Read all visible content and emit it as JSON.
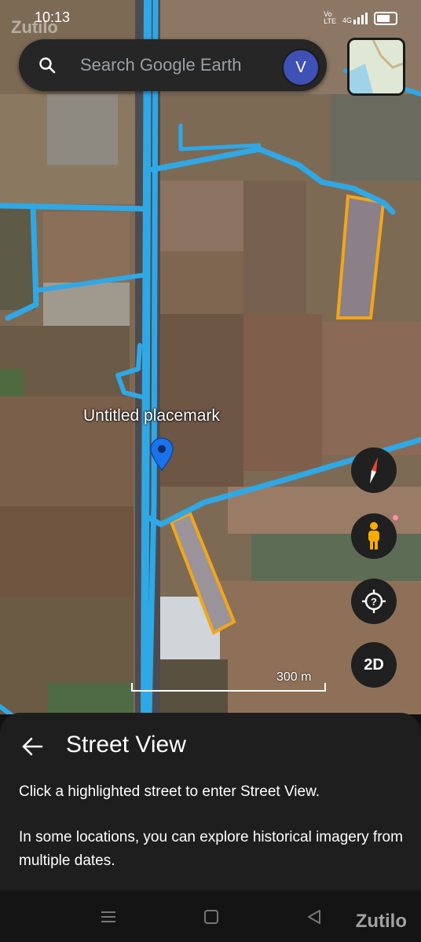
{
  "status_bar": {
    "time": "10:13",
    "watermark": "Zutilo",
    "network_label": "4G"
  },
  "search": {
    "placeholder": "Search Google Earth",
    "avatar_initial": "V"
  },
  "map": {
    "placemark_label": "Untitled placemark",
    "scale_label": "300 m"
  },
  "controls": {
    "view_mode_label": "2D"
  },
  "street_view_panel": {
    "title": "Street View",
    "line1": "Click a highlighted street to enter Street View.",
    "line2": "In some locations, you can explore historical imagery from multiple dates."
  },
  "watermark_bottom": "Zutilo",
  "colors": {
    "street_highlight": "#2fa8e6",
    "field_outline": "#f2a619",
    "pin": "#1a73e8",
    "panel_bg": "#1e1e1e"
  }
}
